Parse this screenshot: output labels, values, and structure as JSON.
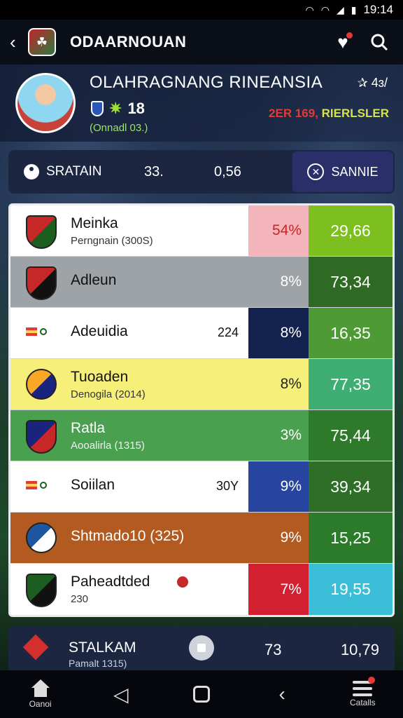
{
  "status_bar": {
    "time": "19:14",
    "icons": [
      "wifi-icon",
      "wifi-icon",
      "signal-icon",
      "battery-icon"
    ]
  },
  "header": {
    "title": "ODAARNOUAN",
    "icons": [
      "back-icon",
      "club-logo",
      "heart-icon",
      "search-icon"
    ]
  },
  "player": {
    "name": "OLAHRAGNANG RINEANSIA",
    "rank": "✰ 4ɜ/",
    "badge_number": "18",
    "subtitle": "(Onnadl 03.)",
    "ratio_red": "2ER 169,",
    "ratio_yellow": "RIERLSLER"
  },
  "stat_bar": {
    "label": "SRATAIN",
    "value1": "33.",
    "value2": "0,56",
    "action_label": "SANNIE"
  },
  "rows": [
    {
      "name": "Meinka",
      "sub": "Perngnain (300S)",
      "mid": "",
      "pct": "54%",
      "value": "29,66",
      "main_bg": "#ffffff",
      "pct_bg": "#f4b4bb",
      "pct_color": "#c62828",
      "val_bg": "#7cbf1f",
      "crest_colors": [
        "#c62828",
        "#1b5e20"
      ],
      "crest_type": "shield"
    },
    {
      "name": "Adleun",
      "sub": "",
      "mid": "",
      "pct": "8%",
      "value": "73,34",
      "main_bg": "#9ea3a8",
      "pct_bg": "#9ea3a8",
      "pct_color": "#ffffff",
      "val_bg": "#2e6a23",
      "crest_colors": [
        "#c62828",
        "#111111"
      ],
      "crest_type": "shield"
    },
    {
      "name": "Adeuidia",
      "sub": "",
      "mid": "224",
      "pct": "8%",
      "value": "16,35",
      "main_bg": "#ffffff",
      "pct_bg": "#14224f",
      "pct_color": "#ffffff",
      "val_bg": "#4e9a34",
      "crest_colors": [],
      "crest_type": "flags"
    },
    {
      "name": "Tuoaden",
      "sub": "Denogila (2014)",
      "mid": "",
      "pct": "8%",
      "value": "77,35",
      "main_bg": "#f6f07a",
      "pct_bg": "#f6f07a",
      "pct_color": "#222222",
      "val_bg": "#3fae73",
      "crest_colors": [
        "#f9a825",
        "#1a237e"
      ],
      "crest_type": "round"
    },
    {
      "name": "Ratla",
      "sub": "Aooalirla (1315)",
      "mid": "",
      "pct": "3%",
      "value": "75,44",
      "main_bg": "#49a04f",
      "pct_bg": "#49a04f",
      "pct_color": "#ffffff",
      "val_bg": "#2e7a2a",
      "crest_colors": [
        "#1a237e",
        "#c62828"
      ],
      "crest_type": "shield"
    },
    {
      "name": "Soiilan",
      "sub": "",
      "mid": "30Y",
      "pct": "9%",
      "value": "39,34",
      "main_bg": "#ffffff",
      "pct_bg": "#27449e",
      "pct_color": "#ffffff",
      "val_bg": "#2f6e27",
      "crest_colors": [],
      "crest_type": "flags"
    },
    {
      "name": "Shtmado10 (325)",
      "sub": "",
      "mid": "",
      "pct": "9%",
      "value": "15,25",
      "main_bg": "#b35a20",
      "pct_bg": "#b35a20",
      "pct_color": "#ffffff",
      "val_bg": "#2b7b2a",
      "crest_colors": [
        "#1e56a0",
        "#ffffff"
      ],
      "crest_type": "round"
    },
    {
      "name": "Paheadtded",
      "sub": "230",
      "mid": "",
      "pct": "7%",
      "value": "19,55",
      "main_bg": "#ffffff",
      "pct_bg": "#d32030",
      "pct_color": "#ffffff",
      "val_bg": "#3bbfd8",
      "crest_colors": [
        "#1b5e20",
        "#111111"
      ],
      "crest_type": "shield"
    }
  ],
  "bottom_card": {
    "title": "STALKAM",
    "sub": "Pamalt 1315)",
    "value1": "73",
    "value2": "10,79"
  },
  "nav": {
    "home_label": "Oanoi",
    "menu_label": "Catalls"
  }
}
